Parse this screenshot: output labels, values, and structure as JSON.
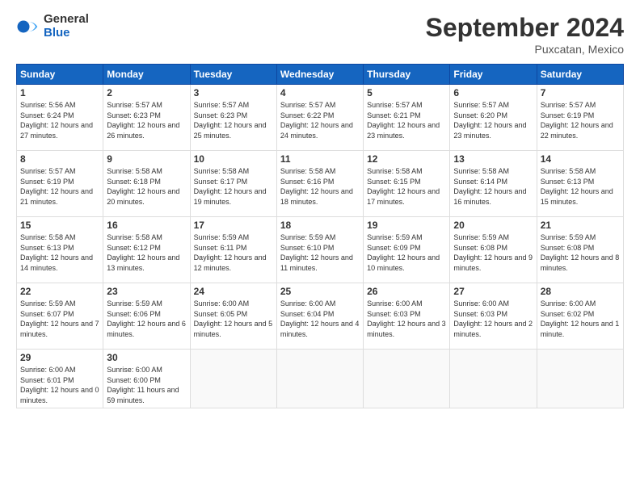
{
  "header": {
    "logo_general": "General",
    "logo_blue": "Blue",
    "month_title": "September 2024",
    "location": "Puxcatan, Mexico"
  },
  "days_of_week": [
    "Sunday",
    "Monday",
    "Tuesday",
    "Wednesday",
    "Thursday",
    "Friday",
    "Saturday"
  ],
  "weeks": [
    [
      {
        "day": "1",
        "sunrise": "5:56 AM",
        "sunset": "6:24 PM",
        "daylight": "12 hours and 27 minutes."
      },
      {
        "day": "2",
        "sunrise": "5:57 AM",
        "sunset": "6:23 PM",
        "daylight": "12 hours and 26 minutes."
      },
      {
        "day": "3",
        "sunrise": "5:57 AM",
        "sunset": "6:23 PM",
        "daylight": "12 hours and 25 minutes."
      },
      {
        "day": "4",
        "sunrise": "5:57 AM",
        "sunset": "6:22 PM",
        "daylight": "12 hours and 24 minutes."
      },
      {
        "day": "5",
        "sunrise": "5:57 AM",
        "sunset": "6:21 PM",
        "daylight": "12 hours and 23 minutes."
      },
      {
        "day": "6",
        "sunrise": "5:57 AM",
        "sunset": "6:20 PM",
        "daylight": "12 hours and 23 minutes."
      },
      {
        "day": "7",
        "sunrise": "5:57 AM",
        "sunset": "6:19 PM",
        "daylight": "12 hours and 22 minutes."
      }
    ],
    [
      {
        "day": "8",
        "sunrise": "5:57 AM",
        "sunset": "6:19 PM",
        "daylight": "12 hours and 21 minutes."
      },
      {
        "day": "9",
        "sunrise": "5:58 AM",
        "sunset": "6:18 PM",
        "daylight": "12 hours and 20 minutes."
      },
      {
        "day": "10",
        "sunrise": "5:58 AM",
        "sunset": "6:17 PM",
        "daylight": "12 hours and 19 minutes."
      },
      {
        "day": "11",
        "sunrise": "5:58 AM",
        "sunset": "6:16 PM",
        "daylight": "12 hours and 18 minutes."
      },
      {
        "day": "12",
        "sunrise": "5:58 AM",
        "sunset": "6:15 PM",
        "daylight": "12 hours and 17 minutes."
      },
      {
        "day": "13",
        "sunrise": "5:58 AM",
        "sunset": "6:14 PM",
        "daylight": "12 hours and 16 minutes."
      },
      {
        "day": "14",
        "sunrise": "5:58 AM",
        "sunset": "6:13 PM",
        "daylight": "12 hours and 15 minutes."
      }
    ],
    [
      {
        "day": "15",
        "sunrise": "5:58 AM",
        "sunset": "6:13 PM",
        "daylight": "12 hours and 14 minutes."
      },
      {
        "day": "16",
        "sunrise": "5:58 AM",
        "sunset": "6:12 PM",
        "daylight": "12 hours and 13 minutes."
      },
      {
        "day": "17",
        "sunrise": "5:59 AM",
        "sunset": "6:11 PM",
        "daylight": "12 hours and 12 minutes."
      },
      {
        "day": "18",
        "sunrise": "5:59 AM",
        "sunset": "6:10 PM",
        "daylight": "12 hours and 11 minutes."
      },
      {
        "day": "19",
        "sunrise": "5:59 AM",
        "sunset": "6:09 PM",
        "daylight": "12 hours and 10 minutes."
      },
      {
        "day": "20",
        "sunrise": "5:59 AM",
        "sunset": "6:08 PM",
        "daylight": "12 hours and 9 minutes."
      },
      {
        "day": "21",
        "sunrise": "5:59 AM",
        "sunset": "6:08 PM",
        "daylight": "12 hours and 8 minutes."
      }
    ],
    [
      {
        "day": "22",
        "sunrise": "5:59 AM",
        "sunset": "6:07 PM",
        "daylight": "12 hours and 7 minutes."
      },
      {
        "day": "23",
        "sunrise": "5:59 AM",
        "sunset": "6:06 PM",
        "daylight": "12 hours and 6 minutes."
      },
      {
        "day": "24",
        "sunrise": "6:00 AM",
        "sunset": "6:05 PM",
        "daylight": "12 hours and 5 minutes."
      },
      {
        "day": "25",
        "sunrise": "6:00 AM",
        "sunset": "6:04 PM",
        "daylight": "12 hours and 4 minutes."
      },
      {
        "day": "26",
        "sunrise": "6:00 AM",
        "sunset": "6:03 PM",
        "daylight": "12 hours and 3 minutes."
      },
      {
        "day": "27",
        "sunrise": "6:00 AM",
        "sunset": "6:03 PM",
        "daylight": "12 hours and 2 minutes."
      },
      {
        "day": "28",
        "sunrise": "6:00 AM",
        "sunset": "6:02 PM",
        "daylight": "12 hours and 1 minute."
      }
    ],
    [
      {
        "day": "29",
        "sunrise": "6:00 AM",
        "sunset": "6:01 PM",
        "daylight": "12 hours and 0 minutes."
      },
      {
        "day": "30",
        "sunrise": "6:00 AM",
        "sunset": "6:00 PM",
        "daylight": "11 hours and 59 minutes."
      },
      null,
      null,
      null,
      null,
      null
    ]
  ],
  "labels": {
    "sunrise": "Sunrise:",
    "sunset": "Sunset:",
    "daylight": "Daylight:"
  }
}
